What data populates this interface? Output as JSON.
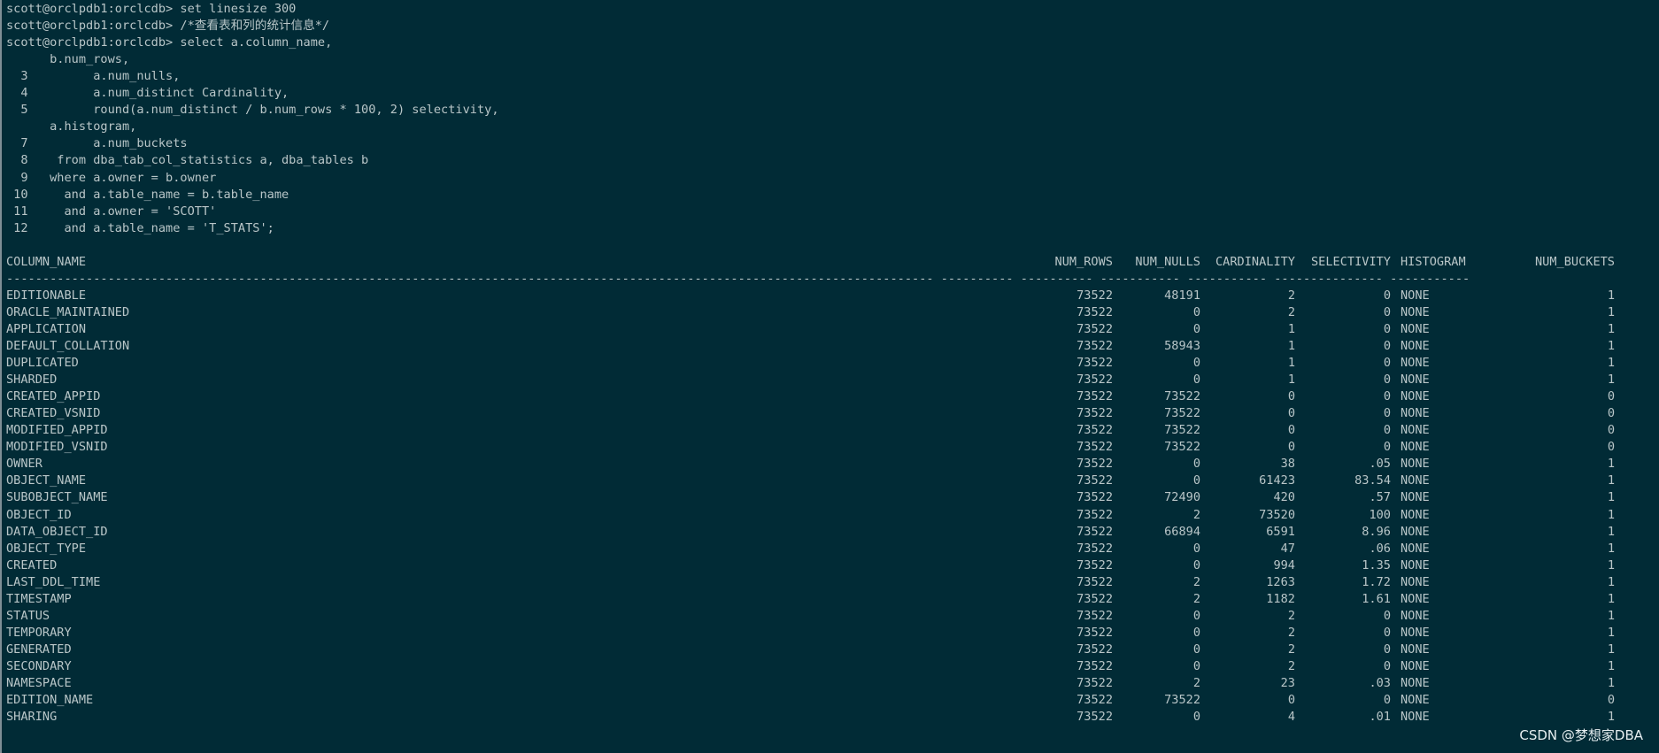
{
  "prompt_lines": [
    "scott@orclpdb1:orclcdb> set linesize 300",
    "scott@orclpdb1:orclcdb> /*查看表和列的统计信息*/",
    "scott@orclpdb1:orclcdb> select a.column_name,"
  ],
  "sql_lines": [
    "      b.num_rows,",
    "  3         a.num_nulls,",
    "  4         a.num_distinct Cardinality,",
    "  5         round(a.num_distinct / b.num_rows * 100, 2) selectivity,",
    "      a.histogram,",
    "  7         a.num_buckets",
    "  8    from dba_tab_col_statistics a, dba_tables b",
    "  9   where a.owner = b.owner",
    " 10     and a.table_name = b.table_name",
    " 11     and a.owner = 'SCOTT'",
    " 12     and a.table_name = 'T_STATS';"
  ],
  "result": {
    "headers": [
      "COLUMN_NAME",
      "NUM_ROWS",
      "NUM_NULLS",
      "CARDINALITY",
      "SELECTIVITY",
      "HISTOGRAM",
      "NUM_BUCKETS"
    ],
    "separator": "-------------------------------------------------------------------------------------------------------------------------------- ---------- ---------- ----------- ----------- --------------- -----------",
    "rows": [
      [
        "EDITIONABLE",
        "73522",
        "48191",
        "2",
        "0",
        "NONE",
        "1"
      ],
      [
        "ORACLE_MAINTAINED",
        "73522",
        "0",
        "2",
        "0",
        "NONE",
        "1"
      ],
      [
        "APPLICATION",
        "73522",
        "0",
        "1",
        "0",
        "NONE",
        "1"
      ],
      [
        "DEFAULT_COLLATION",
        "73522",
        "58943",
        "1",
        "0",
        "NONE",
        "1"
      ],
      [
        "DUPLICATED",
        "73522",
        "0",
        "1",
        "0",
        "NONE",
        "1"
      ],
      [
        "SHARDED",
        "73522",
        "0",
        "1",
        "0",
        "NONE",
        "1"
      ],
      [
        "CREATED_APPID",
        "73522",
        "73522",
        "0",
        "0",
        "NONE",
        "0"
      ],
      [
        "CREATED_VSNID",
        "73522",
        "73522",
        "0",
        "0",
        "NONE",
        "0"
      ],
      [
        "MODIFIED_APPID",
        "73522",
        "73522",
        "0",
        "0",
        "NONE",
        "0"
      ],
      [
        "MODIFIED_VSNID",
        "73522",
        "73522",
        "0",
        "0",
        "NONE",
        "0"
      ],
      [
        "OWNER",
        "73522",
        "0",
        "38",
        ".05",
        "NONE",
        "1"
      ],
      [
        "OBJECT_NAME",
        "73522",
        "0",
        "61423",
        "83.54",
        "NONE",
        "1"
      ],
      [
        "SUBOBJECT_NAME",
        "73522",
        "72490",
        "420",
        ".57",
        "NONE",
        "1"
      ],
      [
        "OBJECT_ID",
        "73522",
        "2",
        "73520",
        "100",
        "NONE",
        "1"
      ],
      [
        "DATA_OBJECT_ID",
        "73522",
        "66894",
        "6591",
        "8.96",
        "NONE",
        "1"
      ],
      [
        "OBJECT_TYPE",
        "73522",
        "0",
        "47",
        ".06",
        "NONE",
        "1"
      ],
      [
        "CREATED",
        "73522",
        "0",
        "994",
        "1.35",
        "NONE",
        "1"
      ],
      [
        "LAST_DDL_TIME",
        "73522",
        "2",
        "1263",
        "1.72",
        "NONE",
        "1"
      ],
      [
        "TIMESTAMP",
        "73522",
        "2",
        "1182",
        "1.61",
        "NONE",
        "1"
      ],
      [
        "STATUS",
        "73522",
        "0",
        "2",
        "0",
        "NONE",
        "1"
      ],
      [
        "TEMPORARY",
        "73522",
        "0",
        "2",
        "0",
        "NONE",
        "1"
      ],
      [
        "GENERATED",
        "73522",
        "0",
        "2",
        "0",
        "NONE",
        "1"
      ],
      [
        "SECONDARY",
        "73522",
        "0",
        "2",
        "0",
        "NONE",
        "1"
      ],
      [
        "NAMESPACE",
        "73522",
        "2",
        "23",
        ".03",
        "NONE",
        "1"
      ],
      [
        "EDITION_NAME",
        "73522",
        "73522",
        "0",
        "0",
        "NONE",
        "0"
      ],
      [
        "SHARING",
        "73522",
        "0",
        "4",
        ".01",
        "NONE",
        "1"
      ]
    ]
  },
  "watermark": "CSDN @梦想家DBA",
  "colors": {
    "background": "#012b36",
    "text": "#b9c6c8",
    "watermark": "#e6eef0"
  }
}
